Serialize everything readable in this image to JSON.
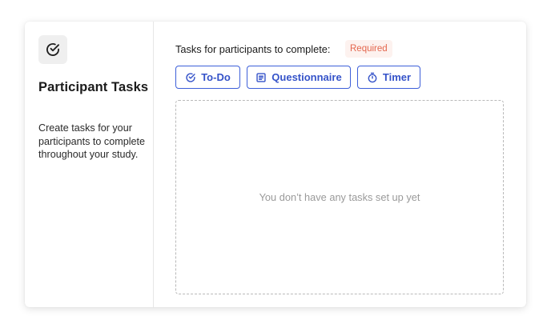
{
  "sidebar": {
    "icon": "check-circle-icon",
    "title": "Participant Tasks",
    "description": "Create tasks for your participants to complete throughout your study."
  },
  "main": {
    "section_label": "Tasks for participants to complete:",
    "required_badge": "Required",
    "task_buttons": [
      {
        "label": "To-Do",
        "icon": "check-circle-icon"
      },
      {
        "label": "Questionnaire",
        "icon": "document-lines-icon"
      },
      {
        "label": "Timer",
        "icon": "stopwatch-icon"
      }
    ],
    "empty_state": "You don’t have any tasks set up yet"
  },
  "colors": {
    "accent": "#3553c9",
    "required_text": "#e4664d",
    "required_bg": "#fdf2ef"
  }
}
